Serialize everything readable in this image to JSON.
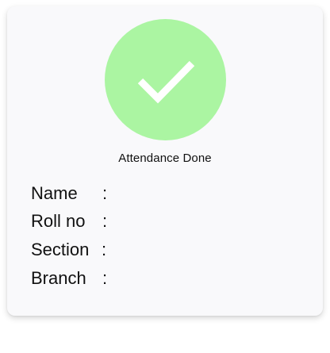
{
  "status": {
    "message": "Attendance Done",
    "icon": "checkmark-icon",
    "circle_color": "#abf5a2"
  },
  "fields": [
    {
      "label": "Name",
      "separator": ":",
      "value": ""
    },
    {
      "label": "Roll no",
      "separator": ":",
      "value": ""
    },
    {
      "label": "Section",
      "separator": ":",
      "value": ""
    },
    {
      "label": "Branch",
      "separator": ":",
      "value": ""
    }
  ]
}
